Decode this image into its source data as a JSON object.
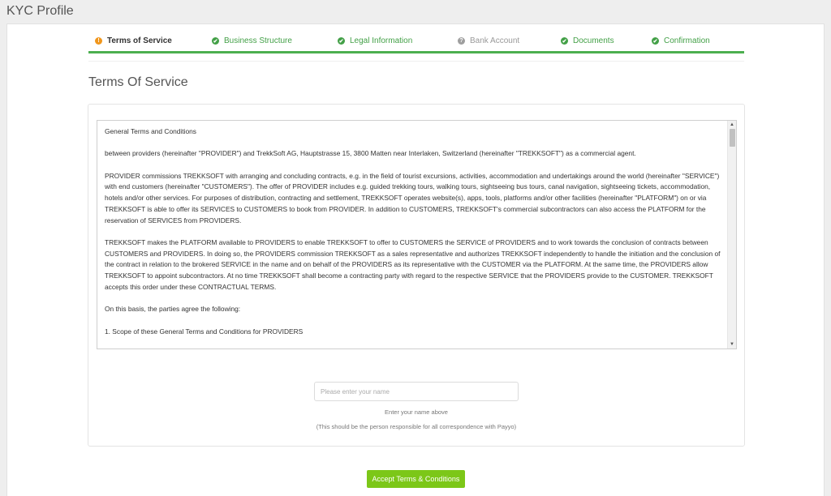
{
  "page": {
    "title": "KYC Profile"
  },
  "steps": [
    {
      "label": "Terms of Service",
      "state": "current",
      "icon": "!"
    },
    {
      "label": "Business Structure",
      "state": "done",
      "icon": "✔"
    },
    {
      "label": "Legal Information",
      "state": "done",
      "icon": "✔"
    },
    {
      "label": "Bank Account",
      "state": "pending",
      "icon": "?"
    },
    {
      "label": "Documents",
      "state": "done",
      "icon": "✔"
    },
    {
      "label": "Confirmation",
      "state": "done",
      "icon": "✔"
    }
  ],
  "section": {
    "title": "Terms Of Service"
  },
  "terms": {
    "paragraphs": [
      "General Terms and Conditions",
      "between providers (hereinafter \"PROVIDER\") and TrekkSoft AG, Hauptstrasse 15, 3800 Matten near Interlaken, Switzerland (hereinafter \"TREKKSOFT\") as a commercial agent.",
      "PROVIDER commissions TREKKSOFT with arranging and concluding contracts, e.g. in the field of tourist excursions, activities, accommodation and undertakings around the world (hereinafter \"SERVICE\") with end customers (hereinafter \"CUSTOMERS\"). The offer of PROVIDER includes e.g. guided trekking tours, walking tours, sightseeing bus tours, canal navigation, sightseeing tickets, accommodation, hotels and/or other services. For purposes of distribution, contracting and settlement, TREKKSOFT operates website(s), apps, tools, platforms and/or other facilities (hereinafter \"PLATFORM\") on or via TREKKSOFT is able to offer its SERVICES to CUSTOMERS to book from PROVIDER. In addition to CUSTOMERS, TREKKSOFT's commercial subcontractors can also access the PLATFORM for the reservation of SERVICES from PROVIDERS.",
      "TREKKSOFT makes the PLATFORM available to PROVIDERS to enable TREKKSOFT to offer to CUSTOMERS the SERVICE of PROVIDERS and to work towards the conclusion of contracts between CUSTOMERS and PROVIDERS. In doing so, the PROVIDERS commission TREKKSOFT as a sales representative and authorizes TREKKSOFT independently to handle the initiation and the conclusion of the contract in relation to the brokered SERVICE in the name and on behalf of the PROVIDERS as its representative with the CUSTOMER via the PLATFORM. At the same time, the PROVIDERS allow TREKKSOFT to appoint subcontractors. At no time TREKKSOFT shall become a contracting party with regard to the respective SERVICE that the PROVIDERS provide to the CUSTOMER. TREKKSOFT accepts this order under these CONTRACTUAL TERMS.",
      "On this basis, the parties agree the following:",
      "1. Scope of these General Terms and Conditions for PROVIDERS"
    ]
  },
  "form": {
    "name_placeholder": "Please enter your name",
    "name_value": "",
    "help": "Enter your name above",
    "help_sub": "(This should be the person responsible for all correspondence with Payyo)"
  },
  "actions": {
    "accept_label": "Accept Terms & Conditions"
  },
  "colors": {
    "accent": "#7cc718",
    "progress": "#4caf50",
    "current": "#f0961c",
    "pending": "#9e9e9e"
  }
}
